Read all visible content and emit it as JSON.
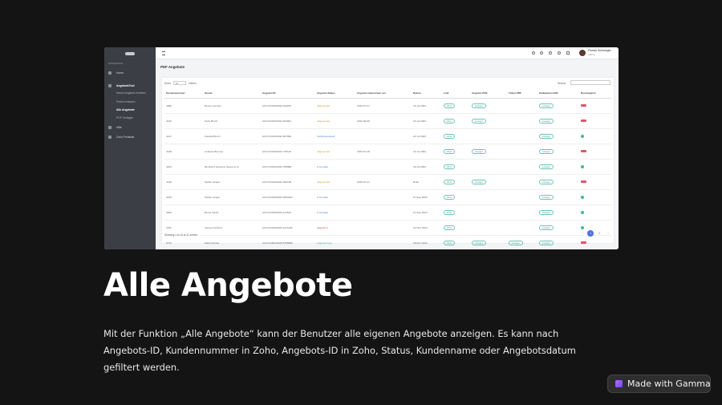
{
  "screenshot": {
    "sidebar": {
      "caption": "NAVIGATION",
      "items": [
        {
          "label": "Home",
          "type": "top"
        },
        {
          "label": "AngebotsTool",
          "type": "bold"
        },
        {
          "label": "Neues Angebot erstellen",
          "type": "sub"
        },
        {
          "label": "Preise erfassen",
          "type": "sub"
        },
        {
          "label": "Alle Angebote",
          "type": "active"
        },
        {
          "label": "PDF Vorlagen",
          "type": "sub"
        },
        {
          "label": "Hilfe",
          "type": "top"
        },
        {
          "label": "Zoho Preisliste",
          "type": "top"
        }
      ]
    },
    "topbar": {
      "user_name": "Florian Schwinger",
      "user_role": "Admin"
    },
    "page_title": "PDF Angebote",
    "table_controls": {
      "show_label": "Show",
      "show_value": "10",
      "entries_label": "entries",
      "search_label": "Search:"
    },
    "columns": [
      "Kundennummer",
      "Kunde",
      "Angebot ID",
      "Angebot Status",
      "Angebot Gekommen am",
      "Datum",
      "Link",
      "Angebot PDF",
      "Ticket PDF",
      "Kalkulation PDF",
      "Bestmöglich"
    ],
    "rows": [
      {
        "nr": "4086",
        "kunde": "Benne Lehmler",
        "id": "AN-FV/2023/2022-010876",
        "status": "abgesendet",
        "status_color": "yellow",
        "gekommen": "2023-07-27",
        "datum": "18 Jul 2023",
        "link": "öffnen",
        "angebot_pdf": "anzeigen",
        "ticket_pdf": "",
        "kalk_pdf": "anzeigen",
        "flag": "red"
      },
      {
        "nr": "4126",
        "kunde": "Karin Bruch",
        "id": "AN-FV/2023/2022-004861",
        "status": "abgesendet",
        "status_color": "yellow",
        "gekommen": "2023-06-06",
        "datum": "20 Jul 2023",
        "link": "öffnen",
        "angebot_pdf": "anzeigen",
        "ticket_pdf": "",
        "kalk_pdf": "anzeigen",
        "flag": "red"
      },
      {
        "nr": "4127",
        "kunde": "Claudia Bruch",
        "id": "AN-FV/2023/2022-007960",
        "status": "Vertriebsentwurf",
        "status_color": "blue",
        "gekommen": "",
        "datum": "20 Jul 2023",
        "link": "öffnen",
        "angebot_pdf": "",
        "ticket_pdf": "",
        "kalk_pdf": "anzeigen",
        "flag": "green"
      },
      {
        "nr": "4128",
        "kunde": "Andreas Brunner",
        "id": "AN-FV/2023/2022-748116",
        "status": "abgesendet",
        "status_color": "yellow",
        "gekommen": "2023-07-28",
        "datum": "22 Jul 2023",
        "link": "öffnen",
        "angebot_pdf": "anzeigen",
        "ticket_pdf": "",
        "kalk_pdf": "anzeigen",
        "flag": "red"
      },
      {
        "nr": "4224",
        "kunde": "Bernhard Seeberer Nexus & co",
        "id": "AN-FV/2023/2022-789888",
        "status": "in Kontakt",
        "status_color": "blue",
        "gekommen": "",
        "datum": "29 Jul 2023",
        "link": "öffnen",
        "angebot_pdf": "",
        "ticket_pdf": "",
        "kalk_pdf": "anzeigen",
        "flag": "green"
      },
      {
        "nr": "4446",
        "kunde": "Stefan Guppe",
        "id": "AN-FV/2023/2022-352196",
        "status": "abgesendet",
        "status_color": "yellow",
        "gekommen": "2023-07-31",
        "datum": "Rolle",
        "link": "öffnen",
        "angebot_pdf": "anzeigen",
        "ticket_pdf": "",
        "kalk_pdf": "anzeigen",
        "flag": "red"
      },
      {
        "nr": "4448",
        "kunde": "Stefan Guppe",
        "id": "AN-FV/2023/2023-0652462",
        "status": "in Kontakt",
        "status_color": "blue",
        "gekommen": "",
        "datum": "07 Sep 2023",
        "link": "öffnen",
        "angebot_pdf": "",
        "ticket_pdf": "",
        "kalk_pdf": "anzeigen",
        "flag": "green"
      },
      {
        "nr": "4660",
        "kunde": "Bruno Hauth",
        "id": "AN-FV/2023/2023-114524",
        "status": "in Kontakt",
        "status_color": "blue",
        "gekommen": "",
        "datum": "07 Sep 2023",
        "link": "öffnen",
        "angebot_pdf": "",
        "ticket_pdf": "",
        "kalk_pdf": "anzeigen",
        "flag": "green"
      },
      {
        "nr": "4781",
        "kunde": "Samuel Schmitt",
        "id": "AN-FV/2024/2023-1071126",
        "status": "abgelehnt",
        "status_color": "red",
        "gekommen": "",
        "datum": "14 Nov 2023",
        "link": "öffnen",
        "angebot_pdf": "",
        "ticket_pdf": "",
        "kalk_pdf": "anzeigen",
        "flag": "green"
      },
      {
        "nr": "6716",
        "kunde": "Martin Kunke",
        "id": "AN-FV/2861/2023-5786886",
        "status": "angenommen",
        "status_color": "green",
        "gekommen": "",
        "datum": "28 Nov 2023",
        "link": "öffnen",
        "angebot_pdf": "anzeigen",
        "ticket_pdf": "anzeigen",
        "kalk_pdf": "anzeigen",
        "flag": "red"
      }
    ],
    "footer_info": "Showing 1 to 10 of 11 entries",
    "pagination": {
      "prev": "‹",
      "pages": [
        "1",
        "2"
      ],
      "current": "1",
      "next": "›"
    }
  },
  "slide": {
    "title": "Alle Angebote",
    "description": "Mit der Funktion „Alle Angebote“ kann der Benutzer alle eigenen Angebote anzeigen. Es kann nach Angebots-ID, Kundennummer in Zoho, Angebots-ID in Zoho, Status, Kundenname oder Angebotsdatum gefiltert werden.",
    "badge": "Made with Gamma"
  },
  "colors": {
    "background": "#141414",
    "sidebar": "#3b3f45",
    "accent": "#4f6fe0",
    "link_pill": "#6cc3b9"
  }
}
